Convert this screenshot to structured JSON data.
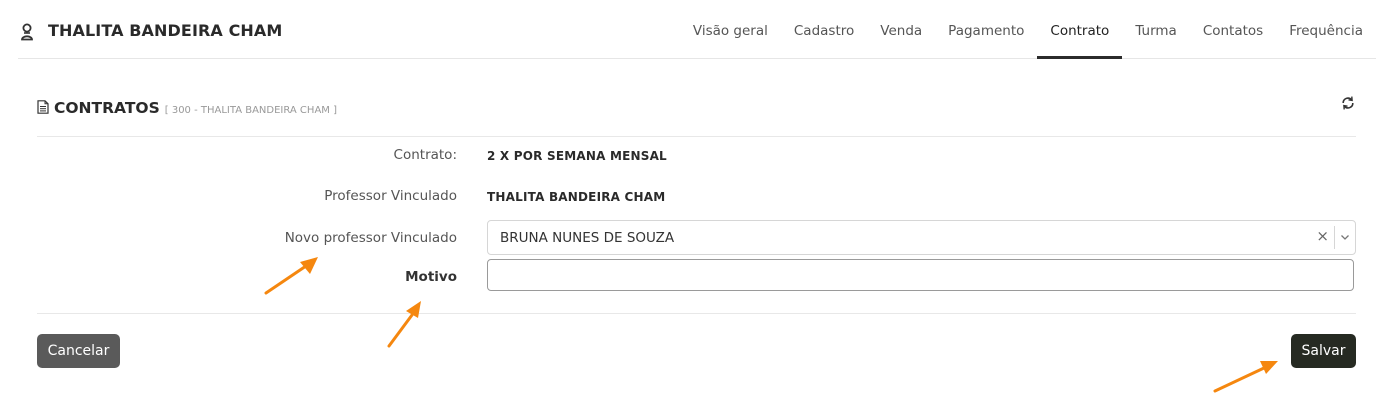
{
  "header": {
    "student_name": "THALITA BANDEIRA CHAM",
    "tabs": [
      "Visão geral",
      "Cadastro",
      "Venda",
      "Pagamento",
      "Contrato",
      "Turma",
      "Contatos",
      "Frequência"
    ],
    "active_tab": "Contrato"
  },
  "card": {
    "title": "CONTRATOS",
    "subtitle": "[ 300 - THALITA BANDEIRA CHAM ]"
  },
  "form": {
    "contrato_label": "Contrato:",
    "contrato_value": "2 X POR SEMANA MENSAL",
    "professor_label": "Professor Vinculado",
    "professor_value": "THALITA BANDEIRA CHAM",
    "novo_professor_label": "Novo professor Vinculado",
    "novo_professor_value": "BRUNA NUNES DE SOUZA",
    "clear_symbol": "×",
    "motivo_label": "Motivo",
    "motivo_value": ""
  },
  "actions": {
    "cancel_label": "Cancelar",
    "save_label": "Salvar"
  },
  "colors": {
    "annotation_arrow": "#f5870f",
    "save_button": "#262a22",
    "cancel_button": "#5a5a5a"
  },
  "icons": [
    "user-icon",
    "document-icon",
    "refresh-icon",
    "chevron-down-icon"
  ]
}
